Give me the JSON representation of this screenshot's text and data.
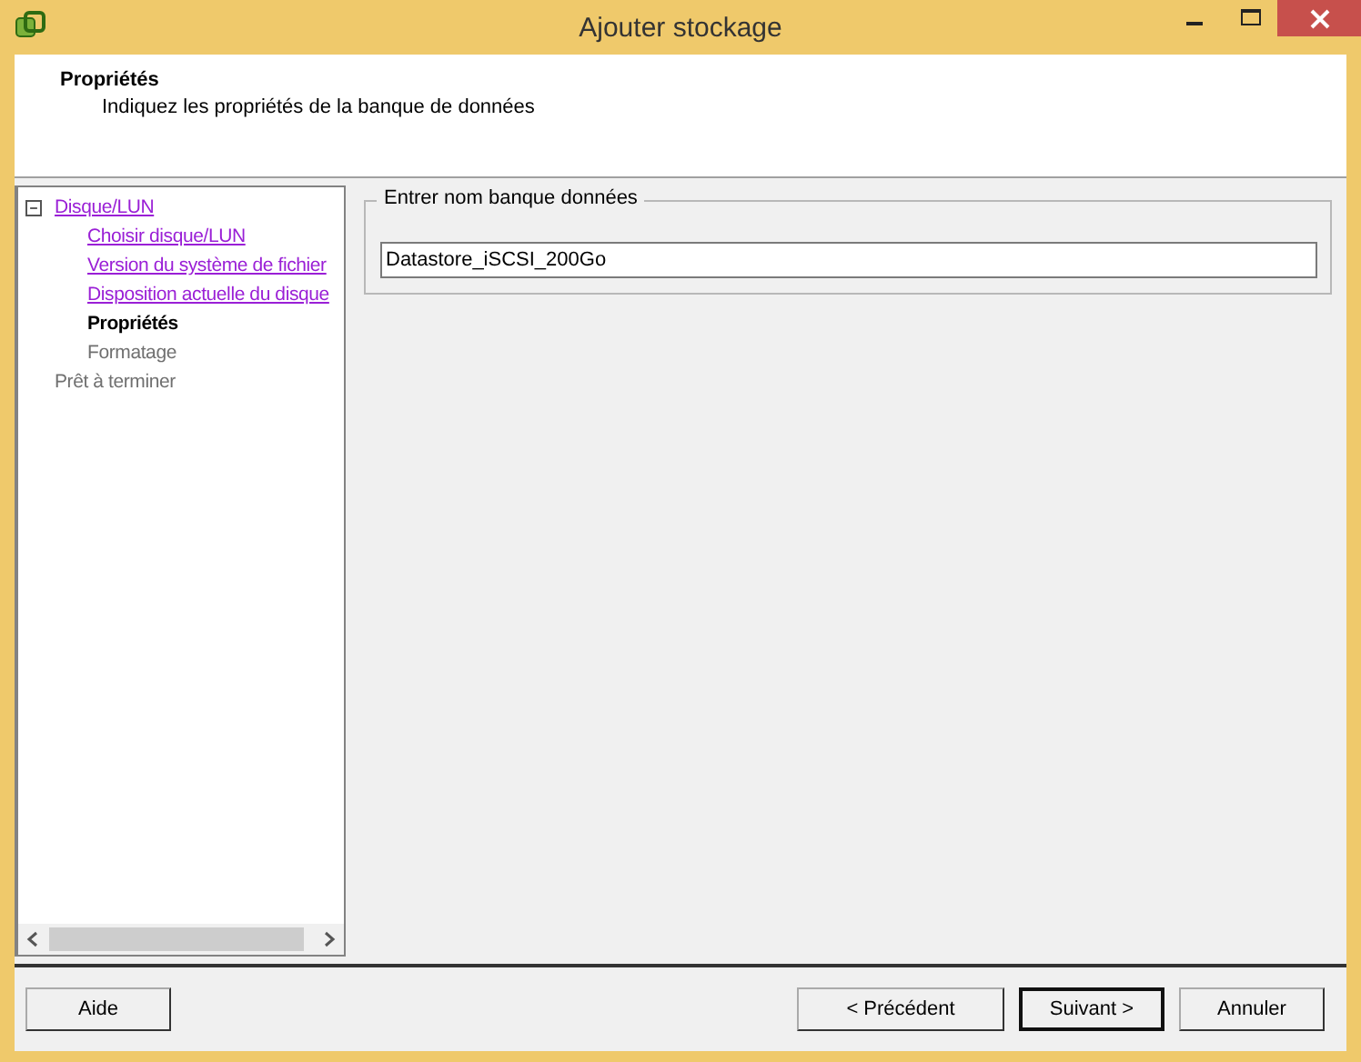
{
  "window": {
    "title": "Ajouter stockage"
  },
  "header": {
    "title": "Propriétés",
    "subtitle": "Indiquez les propriétés de la banque de données"
  },
  "tree": [
    {
      "label": "Disque/LUN",
      "kind": "link",
      "expanded": true,
      "children": [
        {
          "label": "Choisir disque/LUN",
          "kind": "link"
        },
        {
          "label": "Version du système de fichier",
          "kind": "link"
        },
        {
          "label": "Disposition actuelle du disque",
          "kind": "link"
        },
        {
          "label": "Propriétés",
          "kind": "current"
        },
        {
          "label": "Formatage",
          "kind": "pending"
        }
      ]
    },
    {
      "label": "Prêt à terminer",
      "kind": "pending"
    }
  ],
  "group": {
    "legend": "Entrer nom banque données",
    "value": "Datastore_iSCSI_200Go"
  },
  "buttons": [
    {
      "label": "Aide",
      "default": false
    },
    {
      "label": "< Précédent",
      "default": false
    },
    {
      "label": "Suivant >",
      "default": true
    },
    {
      "label": "Annuler",
      "default": false
    }
  ]
}
